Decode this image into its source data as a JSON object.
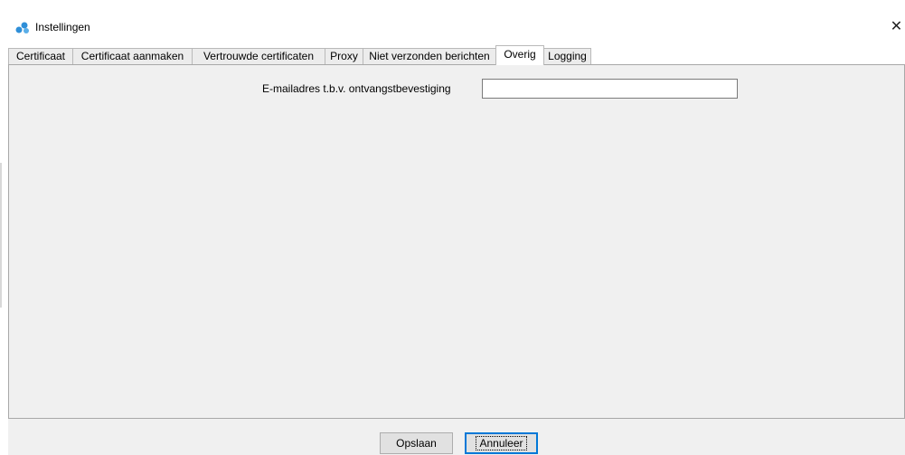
{
  "window": {
    "title": "Instellingen",
    "icon": "app-logo-icon",
    "close_glyph": "✕"
  },
  "tabs": [
    {
      "label": "Certificaat",
      "active": false
    },
    {
      "label": "Certificaat aanmaken",
      "active": false
    },
    {
      "label": "Vertrouwde certificaten",
      "active": false
    },
    {
      "label": "Proxy",
      "active": false
    },
    {
      "label": "Niet verzonden berichten",
      "active": false
    },
    {
      "label": "Overig",
      "active": true
    },
    {
      "label": "Logging",
      "active": false
    }
  ],
  "form": {
    "email_label": "E-mailadres t.b.v. ontvangstbevestiging",
    "email_value": "",
    "email_placeholder": ""
  },
  "buttons": {
    "save_label": "Opslaan",
    "cancel_label": "Annuleer"
  },
  "colors": {
    "accent": "#0078d7",
    "logo_blue": "#2f8fd8",
    "panel_bg": "#f0f0f0"
  }
}
